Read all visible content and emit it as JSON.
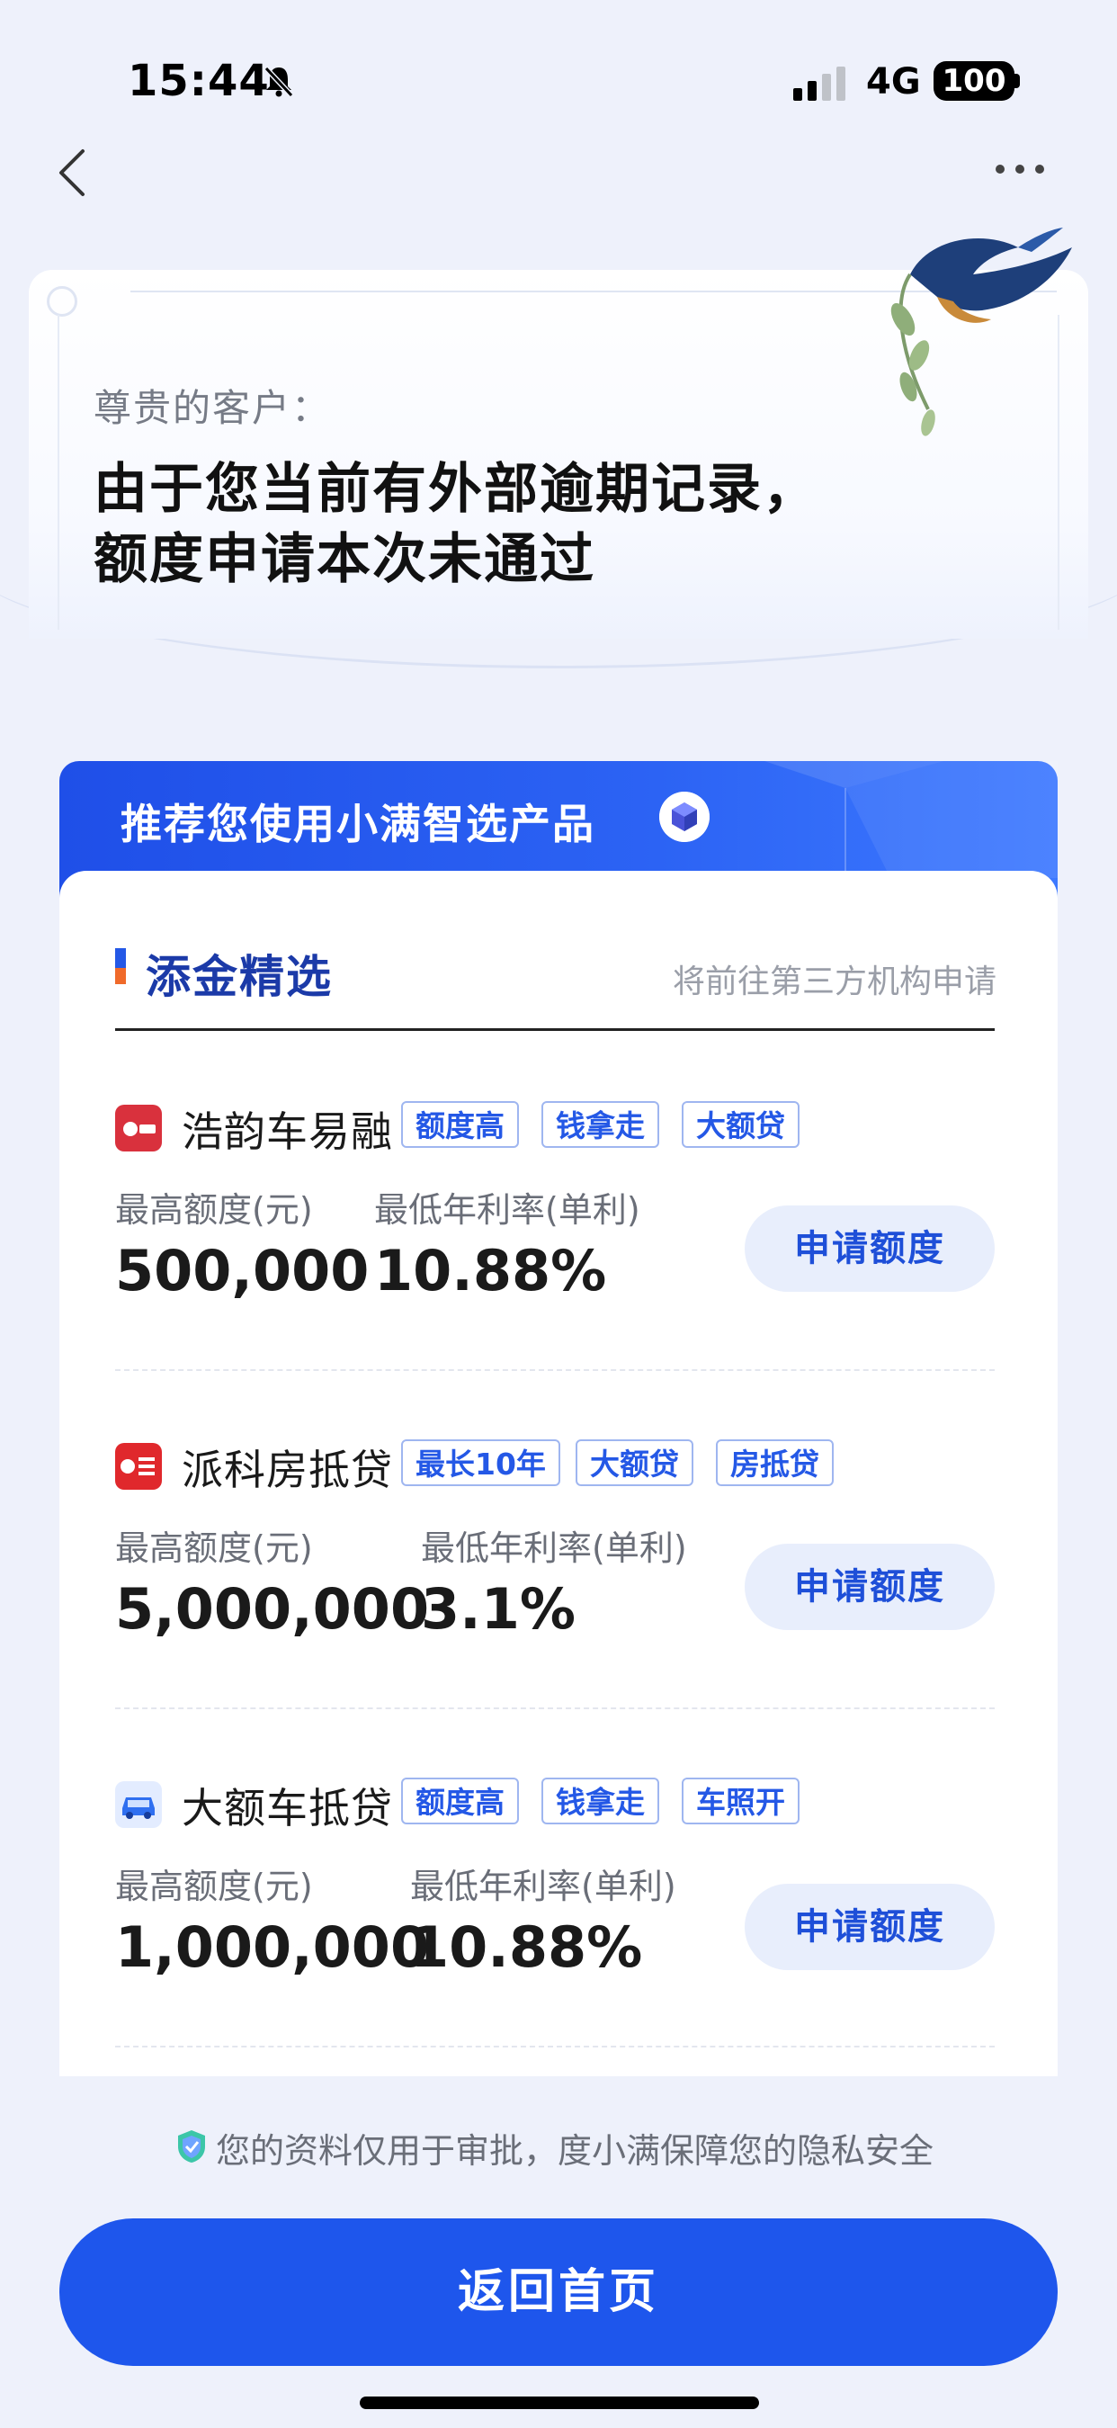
{
  "status_bar": {
    "time": "15:44",
    "network": "4G",
    "battery": "100"
  },
  "notice": {
    "greeting": "尊贵的客户：",
    "headline_line1": "由于您当前有外部逾期记录，",
    "headline_line2": "额度申请本次未通过"
  },
  "recommend": {
    "title": "推荐您使用小满智选产品",
    "section_title": "添金精选",
    "section_note": "将前往第三方机构申请"
  },
  "products": [
    {
      "name": "浩韵车易融",
      "logo_color": "#d9313d",
      "tags": [
        "额度高",
        "钱拿走",
        "大额贷"
      ],
      "max_label": "最高额度(元)",
      "max_value": "500,000",
      "rate_label": "最低年利率(单利)",
      "rate_value": "10.88%",
      "apply_label": "申请额度"
    },
    {
      "name": "派科房抵贷",
      "logo_color": "#e0282c",
      "tags": [
        "最长10年",
        "大额贷",
        "房抵贷"
      ],
      "max_label": "最高额度(元)",
      "max_value": "5,000,000",
      "rate_label": "最低年利率(单利)",
      "rate_value": "3.1%",
      "apply_label": "申请额度"
    },
    {
      "name": "大额车抵贷",
      "logo_color": "#2f6ff0",
      "tags": [
        "额度高",
        "钱拿走",
        "车照开"
      ],
      "max_label": "最高额度(元)",
      "max_value": "1,000,000",
      "rate_label": "最低年利率(单利)",
      "rate_value": "10.88%",
      "apply_label": "申请额度"
    }
  ],
  "footer": {
    "privacy": "您的资料仅用于审批，度小满保障您的隐私安全",
    "home_button": "返回首页"
  },
  "colors": {
    "primary": "#1e56ec",
    "tag_text": "#2458e6",
    "section_title": "#1b3aa8"
  }
}
